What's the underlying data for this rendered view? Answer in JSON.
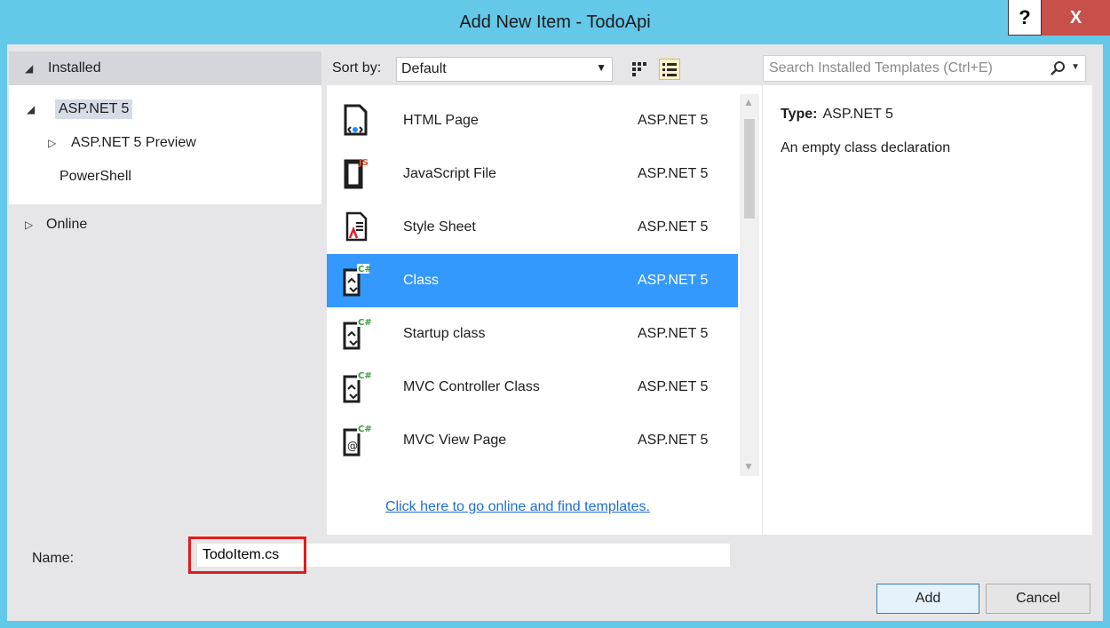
{
  "window": {
    "title": "Add New Item - TodoApi",
    "help_label": "?",
    "close_label": "X"
  },
  "tree": {
    "installed_label": "Installed",
    "items": [
      {
        "label": "ASP.NET 5"
      },
      {
        "label": "ASP.NET 5 Preview"
      },
      {
        "label": "PowerShell"
      }
    ],
    "online_label": "Online"
  },
  "sort": {
    "label": "Sort by:",
    "value": "Default"
  },
  "search": {
    "placeholder": "Search Installed Templates (Ctrl+E)"
  },
  "templates": [
    {
      "name": "HTML Page",
      "category": "ASP.NET 5",
      "icon": "html-page-icon"
    },
    {
      "name": "JavaScript File",
      "category": "ASP.NET 5",
      "icon": "javascript-file-icon"
    },
    {
      "name": "Style Sheet",
      "category": "ASP.NET 5",
      "icon": "style-sheet-icon"
    },
    {
      "name": "Class",
      "category": "ASP.NET 5",
      "icon": "csharp-class-icon",
      "selected": true
    },
    {
      "name": "Startup class",
      "category": "ASP.NET 5",
      "icon": "csharp-class-icon"
    },
    {
      "name": "MVC Controller Class",
      "category": "ASP.NET 5",
      "icon": "csharp-class-icon"
    },
    {
      "name": "MVC View Page",
      "category": "ASP.NET 5",
      "icon": "razor-view-icon"
    }
  ],
  "online_link": "Click here to go online and find templates.",
  "details": {
    "type_label": "Type:",
    "type_value": "ASP.NET 5",
    "description": "An empty class declaration"
  },
  "form": {
    "name_label": "Name:",
    "name_value": "TodoItem.cs",
    "add_label": "Add",
    "cancel_label": "Cancel"
  },
  "colors": {
    "title_bar": "#64c8e8",
    "selection": "#3399ff",
    "close": "#c7504a",
    "highlight": "#e41b1b"
  }
}
